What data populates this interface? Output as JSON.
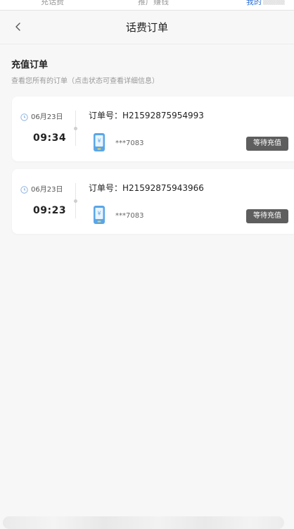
{
  "top_tabs": [
    {
      "label": "充话费"
    },
    {
      "label": "推广赚钱"
    },
    {
      "label": "我的"
    }
  ],
  "colors": {
    "active_tab": "#2c6fd6",
    "status_badge_bg": "#5e5e5e",
    "page_bg": "#f7f7f7",
    "phone_icon": "#5aa6e8"
  },
  "header": {
    "back_icon": "chevron-left-icon",
    "title": "话费订单"
  },
  "section": {
    "title": "充值订单",
    "subtitle": "查看您所有的订单（点击状态可查看详细信息）"
  },
  "orders": [
    {
      "date": "06月23日",
      "time": "09:34",
      "order_no": "订单号：H21592875954993",
      "masked_number": "***7083",
      "status": "等待充值"
    },
    {
      "date": "06月23日",
      "time": "09:23",
      "order_no": "订单号：H21592875943966",
      "masked_number": "***7083",
      "status": "等待充值"
    }
  ]
}
